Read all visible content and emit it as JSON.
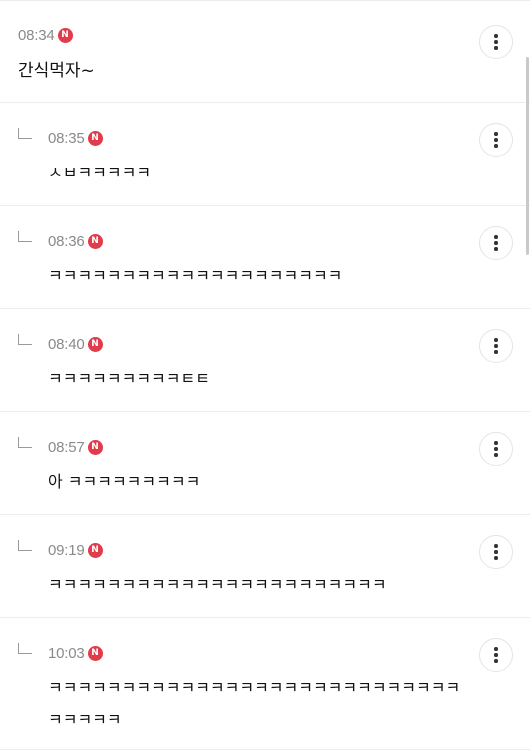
{
  "comments": [
    {
      "type": "parent",
      "time": "08:34",
      "badge": "N",
      "text": "간식먹자~"
    },
    {
      "type": "reply",
      "time": "08:35",
      "badge": "N",
      "text": "ㅅㅂㅋㅋㅋㅋㅋ"
    },
    {
      "type": "reply",
      "time": "08:36",
      "badge": "N",
      "text": "ㅋㅋㅋㅋㅋㅋㅋㅋㅋㅋㅋㅋㅋㅋㅋㅋㅋㅋㅋㅋ"
    },
    {
      "type": "reply",
      "time": "08:40",
      "badge": "N",
      "text": "ㅋㅋㅋㅋㅋㅋㅋㅋㅋㅌㅌ"
    },
    {
      "type": "reply",
      "time": "08:57",
      "badge": "N",
      "text": "아 ㅋㅋㅋㅋㅋㅋㅋㅋㅋ"
    },
    {
      "type": "reply",
      "time": "09:19",
      "badge": "N",
      "text": "ㅋㅋㅋㅋㅋㅋㅋㅋㅋㅋㅋㅋㅋㅋㅋㅋㅋㅋㅋㅋㅋㅋㅋ"
    },
    {
      "type": "reply",
      "time": "10:03",
      "badge": "N",
      "text": "ㅋㅋㅋㅋㅋㅋㅋㅋㅋㅋㅋㅋㅋㅋㅋㅋㅋㅋㅋㅋㅋㅋㅋㅋㅋㅋㅋㅋㅋㅋㅋㅋㅋ"
    }
  ],
  "icons": {
    "new_badge": "new-badge-icon",
    "reply": "reply-arrow-icon",
    "more": "more-vertical-icon"
  },
  "colors": {
    "badge": "#e03c4b",
    "time": "#8a8a8a",
    "divider": "#ececec"
  }
}
